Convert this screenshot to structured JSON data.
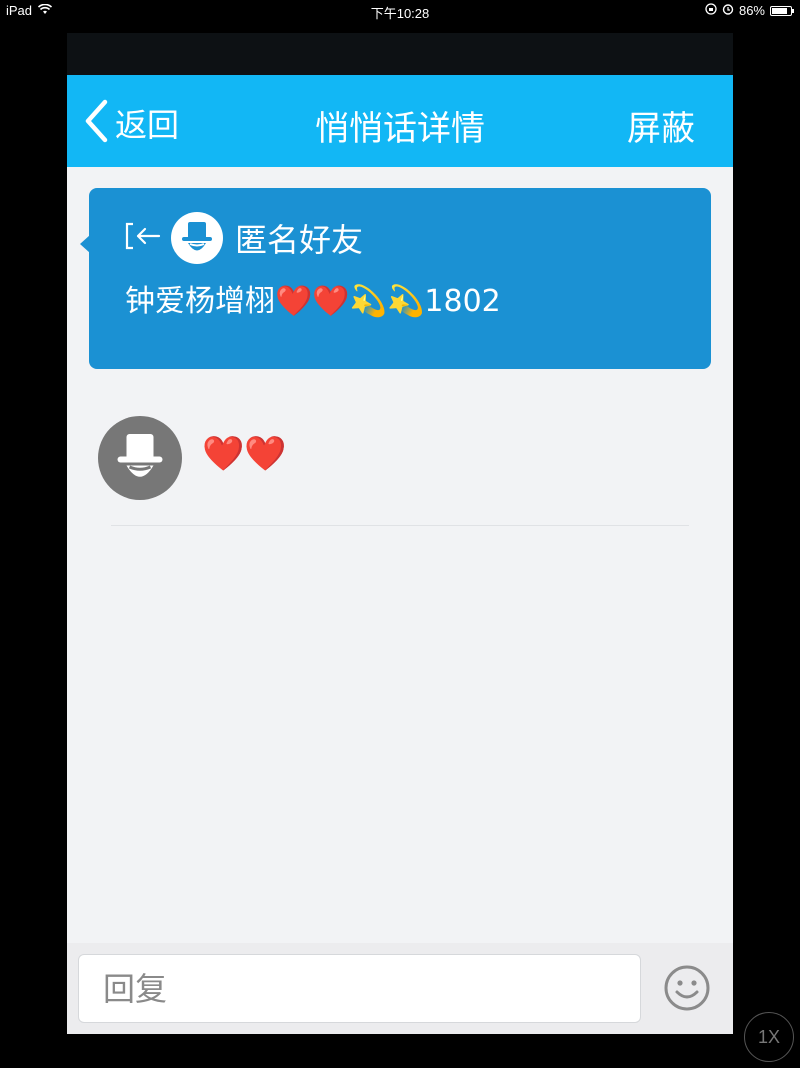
{
  "status_bar": {
    "device": "iPad",
    "time": "下午10:28",
    "battery": "86%",
    "battery_level": 0.86,
    "icons": [
      "wifi-icon",
      "rotation-lock-icon",
      "alarm-icon",
      "battery-icon"
    ]
  },
  "nav": {
    "back_label": "返回",
    "title": "悄悄话详情",
    "right_action": "屏蔽",
    "background": "#12b7f5"
  },
  "message_card": {
    "sender": "匿名好友",
    "text": "钟爱杨增栩❤️❤️💫💫1802",
    "background": "#1b91d3"
  },
  "reply": {
    "text": "❤️❤️"
  },
  "input": {
    "placeholder": "回复"
  },
  "speed_button": {
    "label": "1X"
  }
}
